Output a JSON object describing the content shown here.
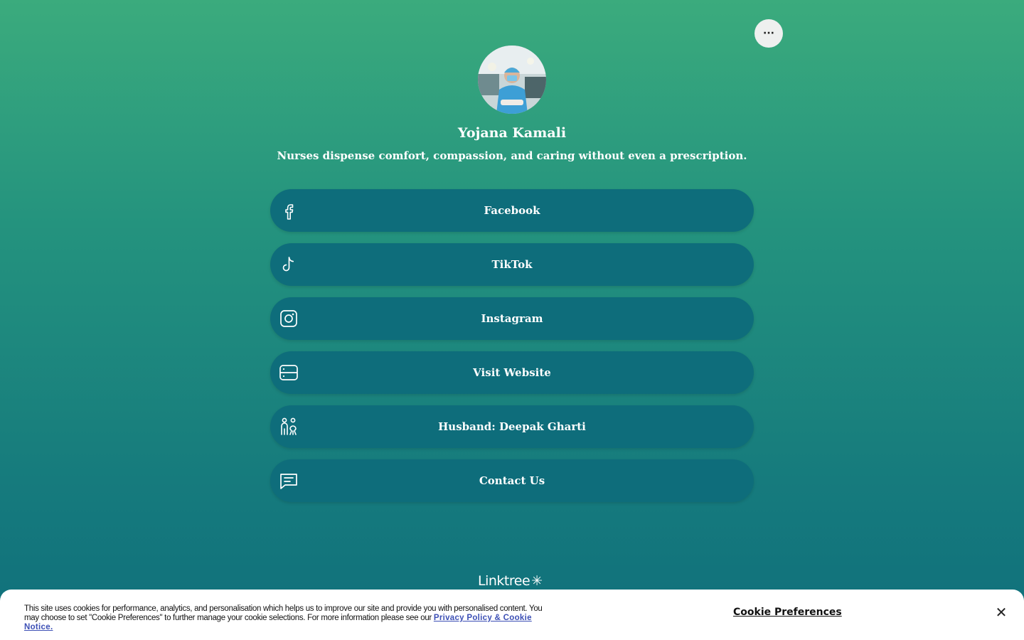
{
  "header": {
    "more_button_label": "···"
  },
  "profile": {
    "name": "Yojana Kamali",
    "bio": "Nurses dispense comfort, compassion, and caring without even a prescription."
  },
  "links": [
    {
      "label": "Facebook",
      "icon": "facebook-icon"
    },
    {
      "label": "TikTok",
      "icon": "tiktok-icon"
    },
    {
      "label": "Instagram",
      "icon": "instagram-icon"
    },
    {
      "label": "Visit Website",
      "icon": "website-icon"
    },
    {
      "label": "Husband: Deepak Gharti",
      "icon": "couple-icon"
    },
    {
      "label": "Contact Us",
      "icon": "chat-icon"
    }
  ],
  "footer": {
    "logo_text": "Linktree",
    "logo_mark": "✳"
  },
  "cookie_banner": {
    "text": "This site uses cookies for performance, analytics, and personalisation which helps us to improve our site and provide you with personalised content. You may choose to set \"Cookie Preferences\" to further manage your cookie selections. For more information please see our ",
    "link_text": "Privacy Policy & Cookie Notice.",
    "preferences_label": "Cookie Preferences",
    "close_label": "✕"
  },
  "colors": {
    "background_top": "#3bab7d",
    "background_bottom": "#0f6f7c",
    "link_button": "#0e6d7b",
    "cookie_link": "#3c4fb5"
  }
}
